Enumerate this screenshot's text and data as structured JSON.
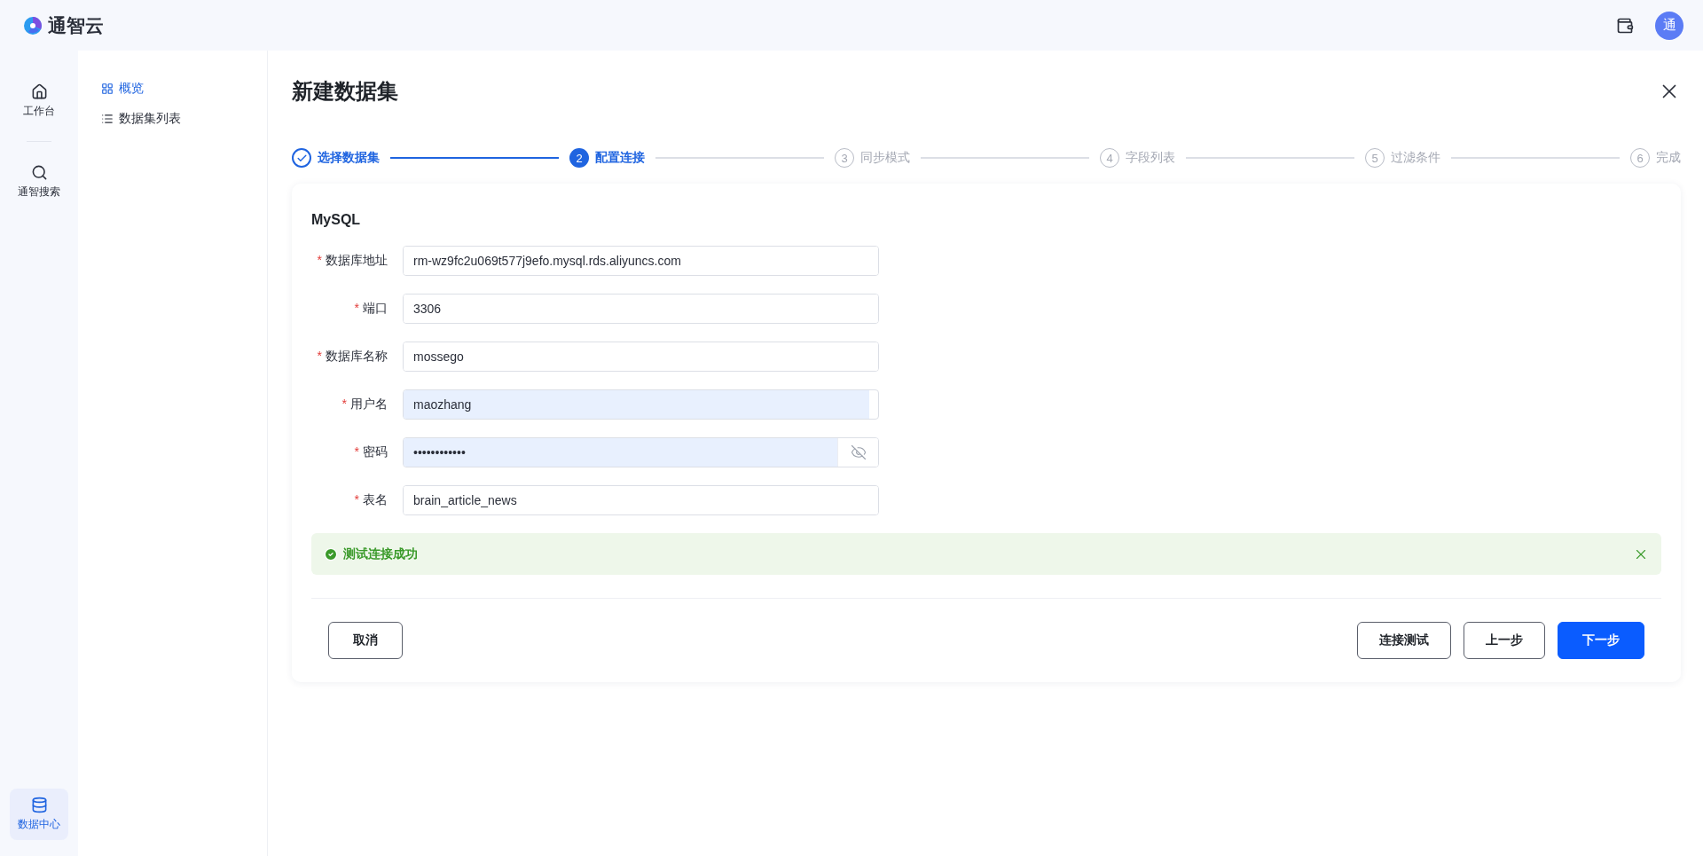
{
  "header": {
    "brand": "通智云",
    "avatar": "通"
  },
  "rail": [
    {
      "label": "工作台",
      "selected": false
    },
    {
      "label": "通智搜索",
      "selected": false
    },
    {
      "label": "数据中心",
      "selected": true
    }
  ],
  "sidebar": {
    "items": [
      {
        "label": "概览",
        "selected": true
      },
      {
        "label": "数据集列表",
        "selected": false
      }
    ]
  },
  "page": {
    "title": "新建数据集"
  },
  "steps": [
    {
      "label": "选择数据集",
      "done": true,
      "selected": false
    },
    {
      "number": "2",
      "label": "配置连接",
      "done": false,
      "selected": true
    },
    {
      "number": "3",
      "label": "同步模式",
      "done": false,
      "selected": false
    },
    {
      "number": "4",
      "label": "字段列表",
      "done": false,
      "selected": false
    },
    {
      "number": "5",
      "label": "过滤条件",
      "done": false,
      "selected": false
    },
    {
      "number": "6",
      "label": "完成",
      "done": false,
      "selected": false
    }
  ],
  "form": {
    "title": "MySQL",
    "fields": [
      {
        "mark": "*",
        "label": "数据库地址",
        "kind": "text",
        "value": "rm-wz9fc2u069t577j9efo.mysql.rds.aliyuncs.com",
        "autofilled": false
      },
      {
        "mark": "*",
        "label": "端口",
        "kind": "text",
        "value": "3306",
        "autofilled": false
      },
      {
        "mark": "*",
        "label": "数据库名称",
        "kind": "text",
        "value": "mossego",
        "autofilled": false
      },
      {
        "mark": "*",
        "label": "用户名",
        "kind": "text",
        "value": "maozhang",
        "autofilled": true
      },
      {
        "mark": "*",
        "label": "密码",
        "kind": "password",
        "value": "••••••••••••",
        "autofilled": true
      },
      {
        "mark": "*",
        "label": "表名",
        "kind": "text",
        "value": "brain_article_news",
        "autofilled": false
      }
    ]
  },
  "alert": {
    "kind": "success",
    "message": "测试连接成功"
  },
  "footer": {
    "cancel": "取消",
    "buttons": [
      {
        "label": "连接测试",
        "kind": "default"
      },
      {
        "label": "上一步",
        "kind": "default"
      },
      {
        "label": "下一步",
        "kind": "primary"
      }
    ]
  }
}
